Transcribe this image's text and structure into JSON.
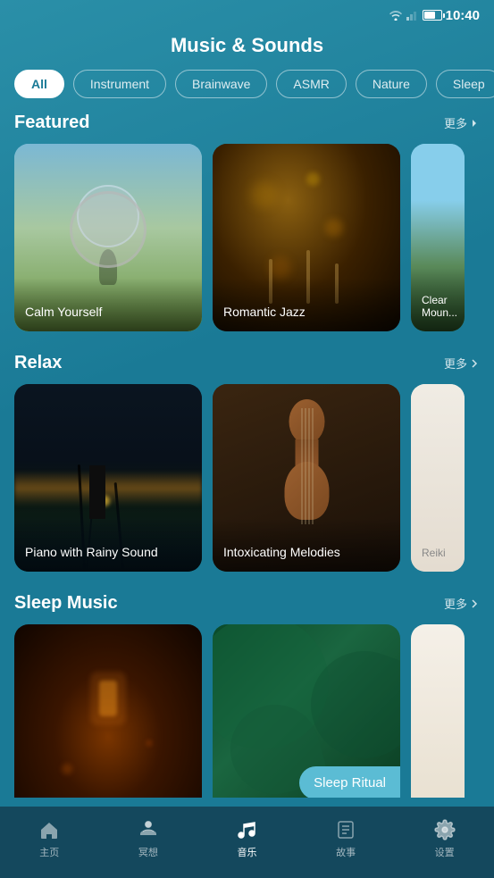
{
  "statusBar": {
    "time": "10:40"
  },
  "header": {
    "title": "Music & Sounds"
  },
  "categories": [
    {
      "id": "all",
      "label": "All",
      "active": true
    },
    {
      "id": "instrument",
      "label": "Instrument",
      "active": false
    },
    {
      "id": "brainwave",
      "label": "Brainwave",
      "active": false
    },
    {
      "id": "asmr",
      "label": "ASMR",
      "active": false
    },
    {
      "id": "nature",
      "label": "Nature",
      "active": false
    },
    {
      "id": "sleep",
      "label": "Sleep",
      "active": false
    }
  ],
  "sections": {
    "featured": {
      "title": "Featured",
      "more": "更多",
      "cards": [
        {
          "id": "calm",
          "label": "Calm Yourself"
        },
        {
          "id": "jazz",
          "label": "Romantic Jazz"
        },
        {
          "id": "mountain",
          "label": "Clear Mountain"
        }
      ]
    },
    "relax": {
      "title": "Relax",
      "more": "更多",
      "cards": [
        {
          "id": "piano",
          "label": "Piano with Rainy Sound"
        },
        {
          "id": "violin",
          "label": "Intoxicating Melodies"
        },
        {
          "id": "reiki",
          "label": "Reiki"
        }
      ]
    },
    "sleep": {
      "title": "Sleep Music",
      "more": "更多",
      "cards": [
        {
          "id": "sleep1",
          "label": ""
        },
        {
          "id": "sleep2",
          "label": ""
        },
        {
          "id": "sleep3",
          "label": ""
        }
      ],
      "badge": "Sleep Ritual"
    }
  },
  "bottomNav": [
    {
      "id": "home",
      "label": "主页",
      "active": false
    },
    {
      "id": "meditation",
      "label": "冥想",
      "active": false
    },
    {
      "id": "music",
      "label": "音乐",
      "active": true
    },
    {
      "id": "stories",
      "label": "故事",
      "active": false
    },
    {
      "id": "settings",
      "label": "设置",
      "active": false
    }
  ]
}
